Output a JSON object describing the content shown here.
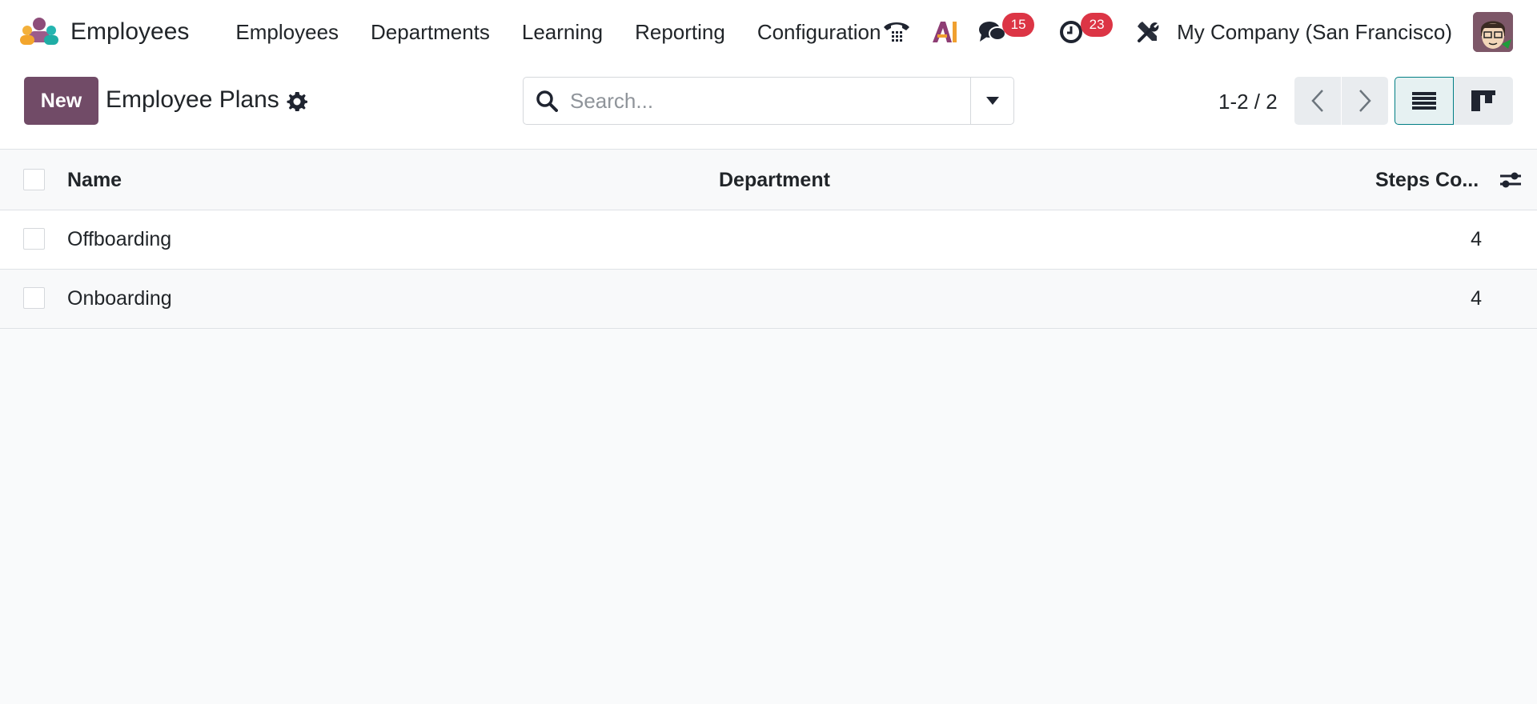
{
  "navbar": {
    "app_name": "Employees",
    "menu": [
      {
        "label": "Employees"
      },
      {
        "label": "Departments"
      },
      {
        "label": "Learning"
      },
      {
        "label": "Reporting"
      },
      {
        "label": "Configuration"
      }
    ],
    "systray": {
      "phone_icon": "phone-icon",
      "ai_icon": "ai-icon",
      "messages_badge": "15",
      "activities_badge": "23",
      "tools_icon": "tools-icon"
    },
    "company": "My Company (San Francisco)"
  },
  "control_panel": {
    "new_label": "New",
    "title": "Employee Plans",
    "search_placeholder": "Search...",
    "pager": "1-2 / 2"
  },
  "table": {
    "headers": {
      "name": "Name",
      "department": "Department",
      "steps": "Steps Co..."
    },
    "rows": [
      {
        "name": "Offboarding",
        "department": "",
        "steps": "4"
      },
      {
        "name": "Onboarding",
        "department": "",
        "steps": "4"
      }
    ]
  },
  "colors": {
    "primary": "#714b67",
    "badge": "#dc3545",
    "view_active": "#017e84"
  }
}
